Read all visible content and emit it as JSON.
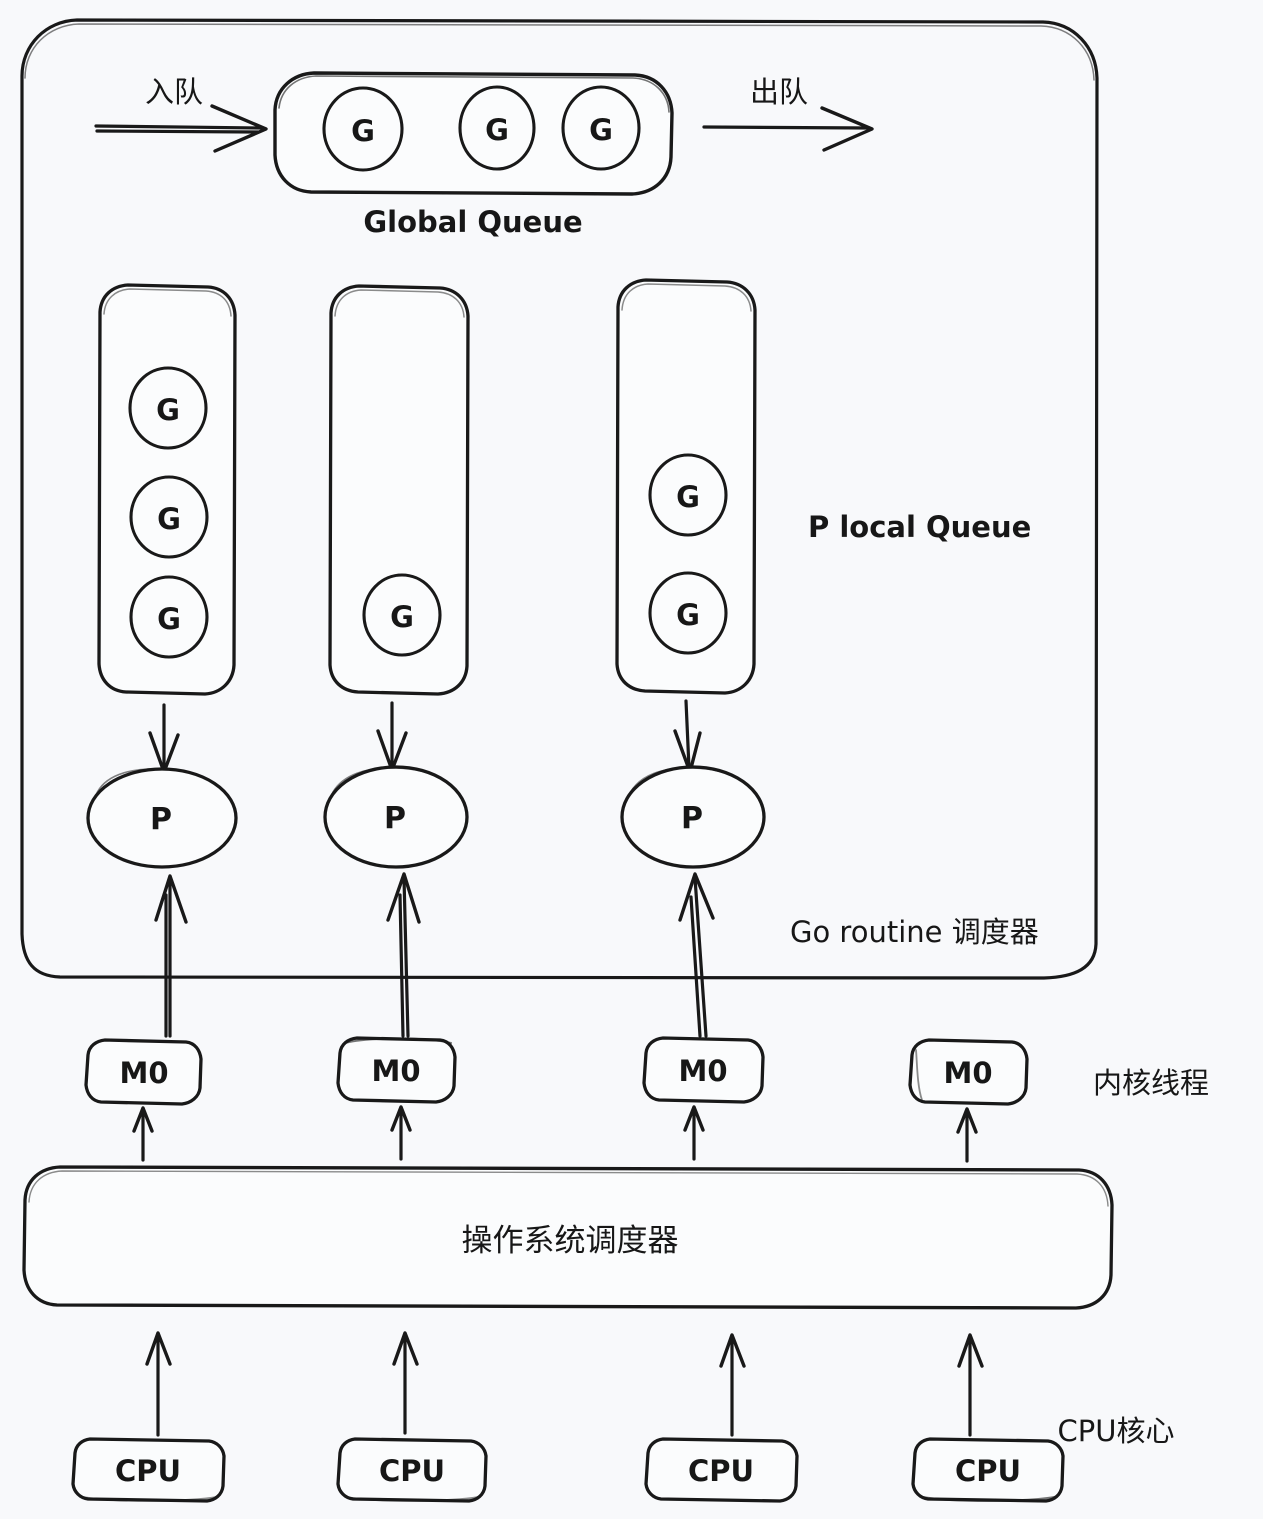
{
  "diagram": {
    "title_semantics": "Go GMP scheduler model diagram",
    "background_color": "#f8f9fb",
    "ink_color": "#191919"
  },
  "top_flow": {
    "enqueue_label": "入队",
    "dequeue_label": "出队"
  },
  "global_queue": {
    "label": "Global Queue",
    "goroutines": [
      {
        "label": "G"
      },
      {
        "label": "G"
      },
      {
        "label": "G"
      }
    ]
  },
  "local_queues": {
    "label": "P local Queue",
    "queues": [
      {
        "id": "p-local-queue-1",
        "goroutine_count": 3,
        "goroutines": [
          {
            "label": "G"
          },
          {
            "label": "G"
          },
          {
            "label": "G"
          }
        ]
      },
      {
        "id": "p-local-queue-2",
        "goroutine_count": 1,
        "goroutines": [
          {
            "label": "G"
          }
        ]
      },
      {
        "id": "p-local-queue-3",
        "goroutine_count": 2,
        "goroutines": [
          {
            "label": "G"
          },
          {
            "label": "G"
          }
        ]
      }
    ]
  },
  "processors": {
    "items": [
      {
        "label": "P"
      },
      {
        "label": "P"
      },
      {
        "label": "P"
      }
    ]
  },
  "scheduler_box": {
    "label": "Go routine 调度器"
  },
  "kernel_threads": {
    "label": "内核线程",
    "items": [
      {
        "label": "M0"
      },
      {
        "label": "M0"
      },
      {
        "label": "M0"
      },
      {
        "label": "M0"
      }
    ]
  },
  "os_scheduler": {
    "label": "操作系统调度器"
  },
  "cpu_cores": {
    "label": "CPU核心",
    "items": [
      {
        "label": "CPU"
      },
      {
        "label": "CPU"
      },
      {
        "label": "CPU"
      },
      {
        "label": "CPU"
      }
    ]
  }
}
